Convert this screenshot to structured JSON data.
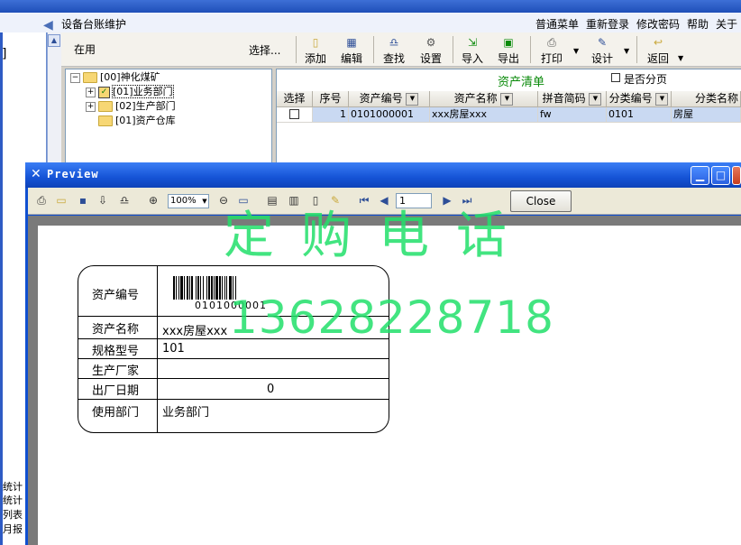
{
  "app": {
    "title": "设备台账维护",
    "menu": [
      "普通菜单",
      "重新登录",
      "修改密码",
      "帮助",
      "关于"
    ]
  },
  "left": {
    "bracket": "]",
    "stats": [
      "统计",
      "统计",
      "列表",
      "月报"
    ]
  },
  "filter": {
    "value": "在用",
    "select_label": "选择..."
  },
  "toolbar": {
    "buttons": [
      {
        "label": "添加",
        "icon": "document-icon"
      },
      {
        "label": "编辑",
        "icon": "grid-icon"
      },
      {
        "label": "查找",
        "icon": "binoculars-icon"
      },
      {
        "label": "设置",
        "icon": "settings-icon"
      },
      {
        "label": "导入",
        "icon": "import-icon"
      },
      {
        "label": "导出",
        "icon": "export-icon"
      },
      {
        "label": "打印",
        "icon": "printer-icon"
      },
      {
        "label": "设计",
        "icon": "design-icon"
      },
      {
        "label": "返回",
        "icon": "return-icon"
      }
    ]
  },
  "tree": {
    "items": [
      "[00]神化煤矿",
      "[01]业务部门",
      "[02]生产部门",
      "[01]资产仓库"
    ]
  },
  "assets": {
    "title": "资产清单",
    "paging_label": "是否分页",
    "columns": [
      "选择",
      "序号",
      "资产编号",
      "资产名称",
      "拼音简码",
      "分类编号",
      "分类名称"
    ],
    "rows": [
      {
        "seq": "1",
        "code": "0101000001",
        "name": "xxx房屋xxx",
        "pinyin": "fw",
        "class_code": "0101",
        "class_name": "房屋"
      }
    ]
  },
  "preview": {
    "title": "Preview",
    "zoom": "100%",
    "page": "1",
    "close_label": "Close",
    "card": {
      "labels": [
        "资产编号",
        "资产名称",
        "规格型号",
        "生产厂家",
        "出厂日期",
        "使用部门"
      ],
      "barcode_text": "0101000001",
      "name": "xxx房屋xxx",
      "model": "101",
      "maker": "",
      "date": "0",
      "dept": "业务部门"
    },
    "watermark_title": "定购电话",
    "watermark_phone": "13628228718"
  },
  "colors": {
    "accent": "#1553d6",
    "watermark": "#22e06a",
    "list_title": "#0a8a0a"
  }
}
